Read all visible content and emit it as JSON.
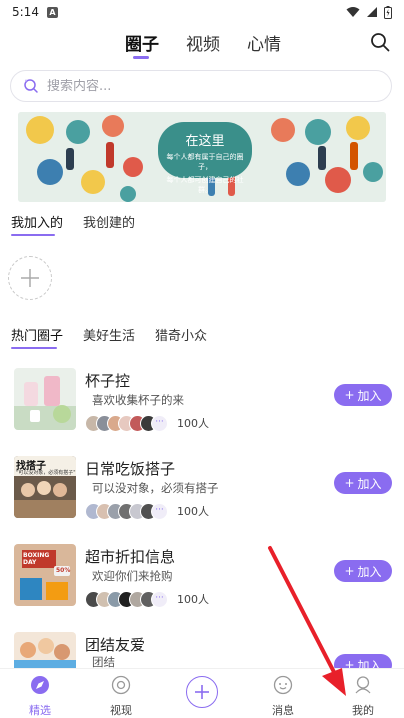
{
  "status": {
    "time": "5:14",
    "badge": "A"
  },
  "top_tabs": [
    "圈子",
    "视频",
    "心情"
  ],
  "search": {
    "placeholder": "搜索内容..."
  },
  "banner": {
    "title": "在这里",
    "line1": "每个人都有属于自己的圈子，",
    "line2": "每个人都可创建自己的社群。"
  },
  "my_tabs": [
    "我加入的",
    "我创建的"
  ],
  "hot_tabs": [
    "热门圈子",
    "美好生活",
    "猎奇小众"
  ],
  "circles": [
    {
      "name": "杯子控",
      "desc": "喜欢收集杯子的来",
      "count": "100人",
      "join": "加入"
    },
    {
      "name": "日常吃饭搭子",
      "desc": "可以没对象，必须有搭子",
      "count": "100人",
      "join": "加入"
    },
    {
      "name": "超市折扣信息",
      "desc": "欢迎你们来抢购",
      "count": "100人",
      "join": "加入"
    },
    {
      "name": "团结友爱",
      "desc": "团结",
      "count": "",
      "join": "加入"
    }
  ],
  "thumbs": {
    "t2_line1": "找搭子",
    "t2_line2": "\"可以没对象，必须有搭子\"",
    "t3_text": "BOXING DAY",
    "t3_badge": "50%"
  },
  "more_symbol": "···",
  "bottom_nav": [
    "精选",
    "视现",
    "消息",
    "我的"
  ],
  "colors": {
    "accent": "#8a6cf0",
    "arrow": "#e8202a"
  }
}
